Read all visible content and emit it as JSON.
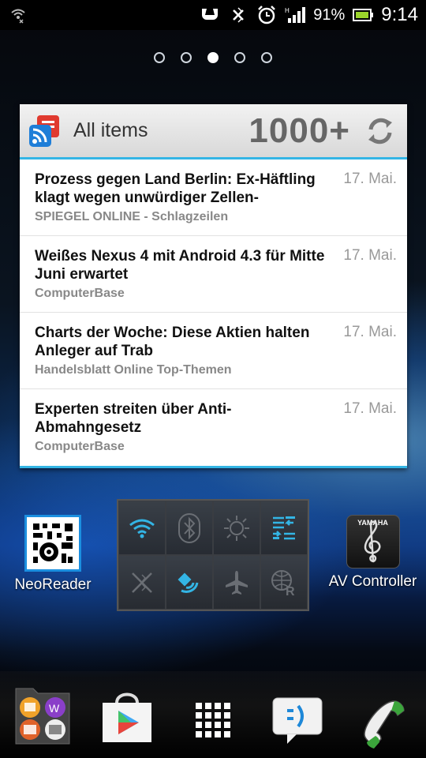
{
  "status_bar": {
    "battery_percent": "91%",
    "time": "9:14",
    "icons": [
      "wifi-icon",
      "usb-icon",
      "bluetooth-off-icon",
      "alarm-icon",
      "signal-icon",
      "battery-icon"
    ]
  },
  "home_pages": {
    "count": 5,
    "active_index": 2
  },
  "widget": {
    "title": "All items",
    "count": "1000+",
    "items": [
      {
        "title": "Prozess gegen Land Berlin: Ex-Häftling klagt wegen unwürdiger Zellen-",
        "source": "SPIEGEL ONLINE - Schlagzeilen",
        "date": "17. Mai."
      },
      {
        "title": "Weißes Nexus 4 mit Android 4.3 für Mitte Juni erwartet",
        "source": "ComputerBase",
        "date": "17. Mai."
      },
      {
        "title": "Charts der Woche: Diese Aktien halten Anleger auf Trab",
        "source": "Handelsblatt Online Top-Themen",
        "date": "17. Mai."
      },
      {
        "title": "Experten streiten über Anti-Abmahngesetz",
        "source": "ComputerBase",
        "date": "17. Mai."
      }
    ]
  },
  "apps": {
    "neoreader": {
      "label": "NeoReader"
    },
    "av_controller": {
      "label": "AV Controller",
      "brand": "YAMAHA"
    }
  },
  "quick_settings": [
    {
      "icon": "wifi-icon",
      "active": true
    },
    {
      "icon": "bluetooth-icon",
      "active": false
    },
    {
      "icon": "brightness-icon",
      "active": false
    },
    {
      "icon": "sync-settings-icon",
      "active": true
    },
    {
      "icon": "nfc-off-icon",
      "active": false
    },
    {
      "icon": "gps-icon",
      "active": true
    },
    {
      "icon": "airplane-icon",
      "active": false
    },
    {
      "icon": "roaming-icon",
      "active": false
    }
  ],
  "dock": [
    "folder-icon",
    "play-store-icon",
    "app-drawer-icon",
    "messaging-icon",
    "phone-icon"
  ],
  "colors": {
    "accent": "#33b5e5",
    "active_icon": "#33b5e5",
    "inactive_icon": "#6a6e74"
  }
}
